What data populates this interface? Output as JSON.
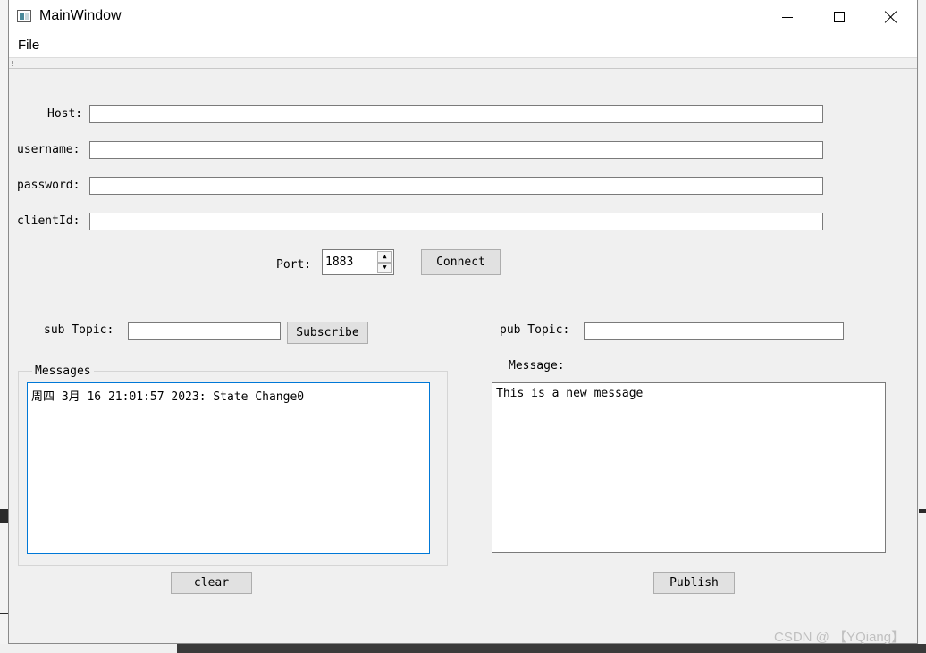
{
  "window": {
    "title": "MainWindow"
  },
  "menu": {
    "file_label": "File"
  },
  "connection": {
    "host_label": "Host:",
    "host_value": "",
    "username_label": "username:",
    "username_value": "",
    "password_label": "password:",
    "password_value": "",
    "clientid_label": "clientId:",
    "clientid_value": "",
    "port_label": "Port:",
    "port_value": "1883",
    "connect_label": "Connect"
  },
  "subscribe": {
    "topic_label": "sub Topic:",
    "topic_value": "",
    "subscribe_label": "Subscribe"
  },
  "publish": {
    "topic_label": "pub Topic:",
    "topic_value": "",
    "message_label": "Message:",
    "message_value": "This is a new message",
    "publish_label": "Publish"
  },
  "messages": {
    "group_title": "Messages",
    "log": "周四 3月 16 21:01:57 2023: State Change0",
    "clear_label": "clear"
  },
  "watermark": {
    "text": "CSDN @ 【YQiang】"
  },
  "icons": {
    "app": "app-window-icon",
    "minimize": "minimize-icon",
    "maximize": "maximize-icon",
    "close": "close-icon",
    "spin_up": "arrow-up-icon",
    "spin_down": "arrow-down-icon"
  },
  "colors": {
    "focus_border": "#0078d7",
    "button_bg": "#e1e1e1",
    "window_bg": "#f0f0f0"
  }
}
